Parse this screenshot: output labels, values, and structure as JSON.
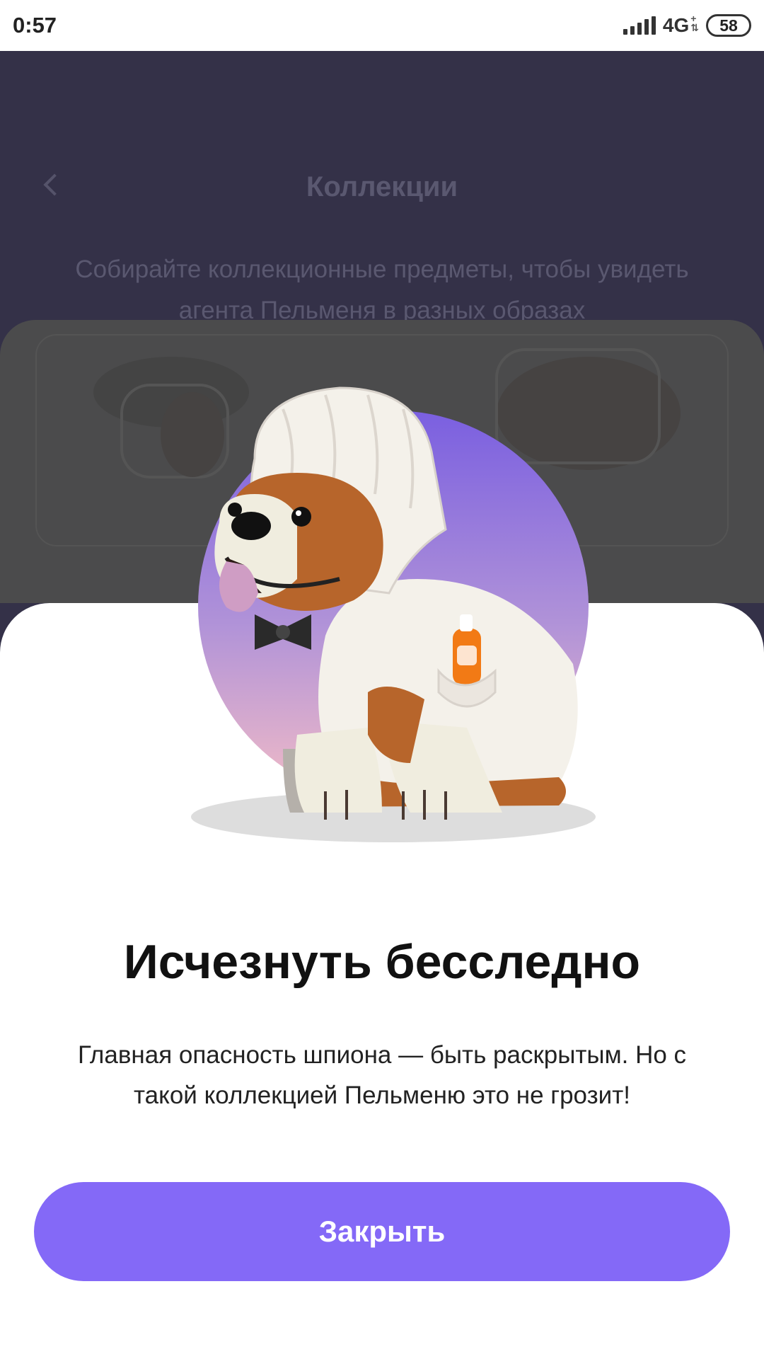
{
  "status_bar": {
    "time": "0:57",
    "network": "4G",
    "battery": "58"
  },
  "background": {
    "title": "Коллекции",
    "subtitle": "Собирайте коллекционные предметы, чтобы увидеть агента Пельменя в разных образах"
  },
  "sheet": {
    "title": "Исчезнуть бесследно",
    "description": "Главная опасность шпиона — быть раскрытым. Но с такой коллекцией Пельменю это не грозит!",
    "close_label": "Закрыть"
  },
  "colors": {
    "accent": "#8469f7",
    "bg_overlay": "#343148",
    "circle_top": "#7a5fe0",
    "circle_bottom": "#f3bcc6"
  }
}
